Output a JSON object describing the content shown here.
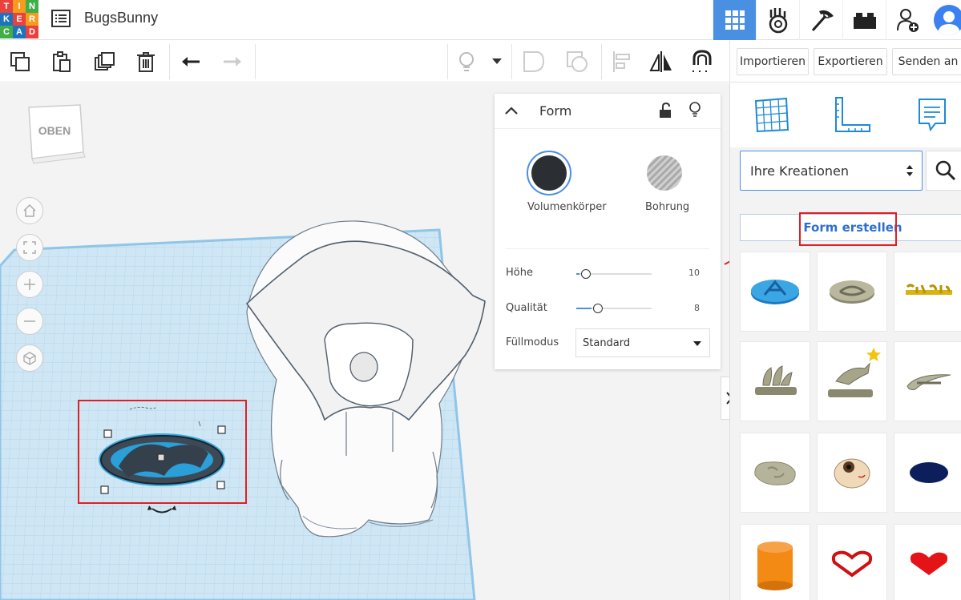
{
  "app": {
    "logo_letters": [
      "T",
      "I",
      "N",
      "K",
      "E",
      "R",
      "C",
      "A",
      "D"
    ],
    "project_title": "BugsBunny"
  },
  "topnav": {
    "items": [
      "3d-design-icon",
      "circuits-icon",
      "codeblocks-icon",
      "bricks-icon",
      "add-user-icon",
      "avatar"
    ]
  },
  "toolbar": {
    "tools": [
      "copy-icon",
      "paste-icon",
      "duplicate-icon",
      "delete-icon",
      "undo-icon",
      "redo-icon",
      "light-bulb-icon",
      "group-icon",
      "ungroup-icon",
      "align-icon",
      "mirror-icon",
      "magnet-icon"
    ],
    "import_label": "Importieren",
    "export_label": "Exportieren",
    "send_label": "Senden an"
  },
  "viewcube": {
    "label": "OBEN"
  },
  "viewcontrols": [
    "home-view-icon",
    "fit-view-icon",
    "zoom-in-icon",
    "zoom-out-icon",
    "ortho-view-icon"
  ],
  "shape_panel": {
    "title": "Form",
    "solid_label": "Volumenkörper",
    "hole_label": "Bohrung",
    "props": {
      "height": {
        "label": "Höhe",
        "value": "10",
        "level": 0.04
      },
      "quality": {
        "label": "Qualität",
        "value": "8",
        "level": 0.2
      },
      "fill": {
        "label": "Füllmodus",
        "value": "Standard"
      }
    }
  },
  "sidebar": {
    "dropdown_value": "Ihre Kreationen",
    "create_button": "Form erstellen",
    "shapes": [
      "blue-logo-disc",
      "grey-logo-disc",
      "yellow-text-shape",
      "adidas-logo-shape",
      "puma-logo-shape",
      "nike-logo-shape",
      "rock-shape",
      "eyeball-shape",
      "blue-oval-shape",
      "orange-cylinder-shape",
      "red-heart-outline-shape",
      "red-heart-shape"
    ]
  },
  "colors": {
    "accent": "#4a90e2",
    "highlight": "#e02020",
    "workplane": "#cfe6f5"
  }
}
